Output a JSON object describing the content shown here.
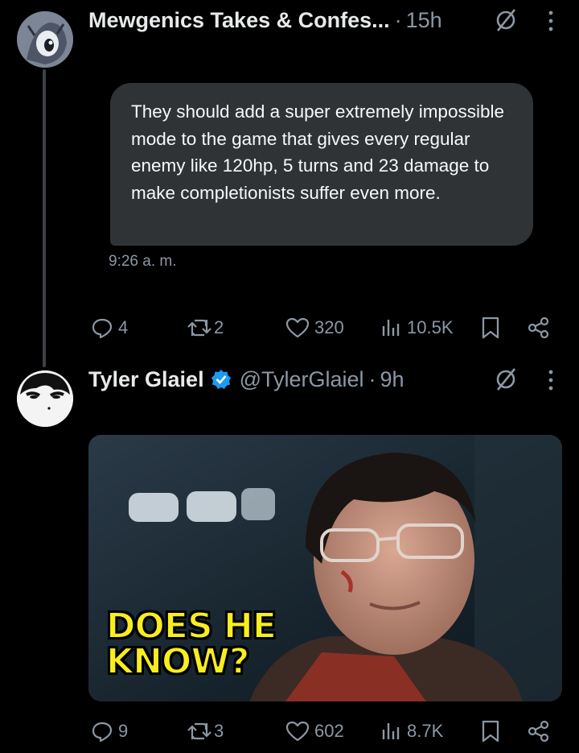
{
  "tweet1": {
    "display_name": "Mewgenics Takes & Confes...",
    "separator": "·",
    "time": "15h",
    "dm_text": "They should add a super extremely impossible mode to the game that gives every regular enemy like 120hp, 5 turns and 23 damage to make completionists suffer even more.",
    "timestamp": "9:26 a. m.",
    "stats": {
      "replies": "4",
      "reposts": "2",
      "likes": "320",
      "views": "10.5K"
    }
  },
  "tweet2": {
    "display_name": "Tyler Glaiel",
    "handle": "@TylerGlaiel",
    "separator": "·",
    "time": "9h",
    "media_caption_line1": "DOES HE",
    "media_caption_line2": "KNOW?",
    "stats": {
      "replies": "9",
      "reposts": "3",
      "likes": "602",
      "views": "8.7K"
    }
  },
  "icons": {
    "grok": "grok-slash-icon",
    "more": "more-vertical-icon",
    "verified": "verified-badge-icon",
    "reply": "reply-icon",
    "repost": "repost-icon",
    "like": "heart-icon",
    "views": "views-icon",
    "bookmark": "bookmark-icon",
    "share": "share-icon"
  },
  "colors": {
    "background": "#000000",
    "bubble": "#303336",
    "muted": "#8b98a5",
    "verified": "#1d9bf0",
    "caption": "#f8ee1f"
  }
}
